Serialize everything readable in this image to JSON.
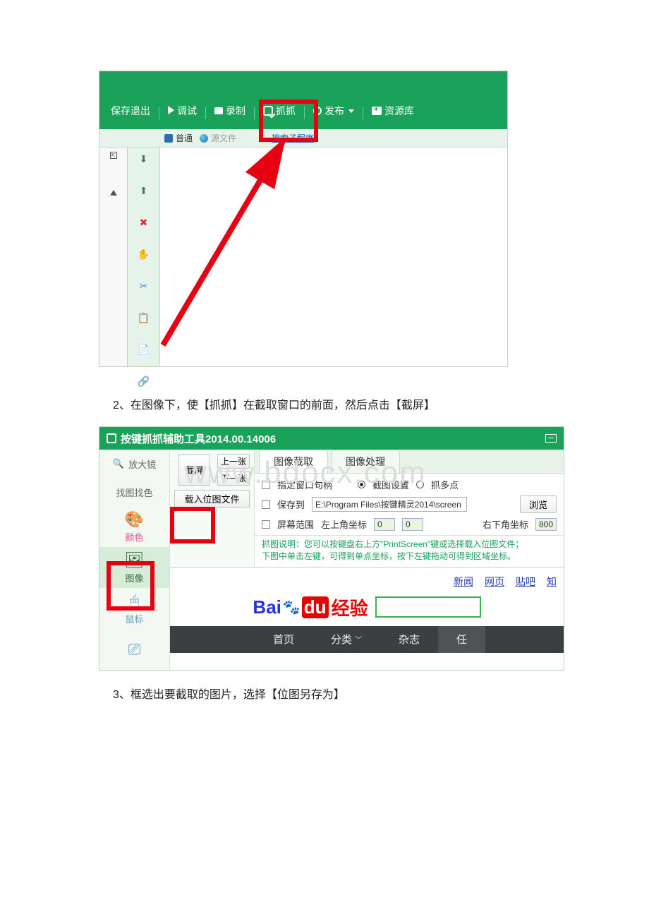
{
  "captions": {
    "step2": "2、在图像下，使【抓抓】在截取窗口的前面，然后点击【截屏】",
    "step3": "3、框选出要截取的图片，选择【位图另存为】"
  },
  "shot1": {
    "toolbar": {
      "save_exit": "保存退出",
      "debug": "调试",
      "record": "录制",
      "grab": "抓抓",
      "publish": "发布",
      "library": "资源库"
    },
    "subbar": {
      "normal": "普通",
      "source": "源文件",
      "search_program": "搜索子程序"
    }
  },
  "shot2": {
    "title": "按键抓抓辅助工具2014.00.14006",
    "left": {
      "magnifier": "放大镜",
      "find_image_color": "找图找色",
      "color": "颜色",
      "image": "图像",
      "mouse": "鼠标"
    },
    "mid": {
      "screenshot": "截屏",
      "prev": "上一张",
      "next": "下一张",
      "load_bitmap": "载入位图文件"
    },
    "tabs": {
      "image_capture": "图像截取",
      "image_process": "图像处理"
    },
    "opts": {
      "window_handle": "指定窗口句柄",
      "capture_settings": "截图设置",
      "multi_point": "抓多点",
      "save_to": "保存到",
      "save_path": "E:\\Program Files\\按键精灵2014\\screen",
      "browse": "浏览",
      "screen_range": "屏幕范围",
      "top_left": "左上角坐标",
      "tl_x": "0",
      "tl_y": "0",
      "bottom_right": "右下角坐标",
      "br_val": "800",
      "help_line1": "抓图说明：您可以按键盘右上方\"PrintScreen\"键或选择载入位图文件；",
      "help_line2": "下图中单击左键，可得到单点坐标，按下左键拖动可得到区域坐标。"
    },
    "baidu": {
      "tabs": {
        "news": "新闻",
        "web": "网页",
        "tieba": "贴吧",
        "more": "知"
      },
      "logo_left": "Bai",
      "logo_du": "du",
      "logo_right": "经验"
    },
    "nav": {
      "home": "首页",
      "category": "分类",
      "magazine": "杂志",
      "task": "任"
    }
  },
  "watermark": "www.bdocx.com"
}
